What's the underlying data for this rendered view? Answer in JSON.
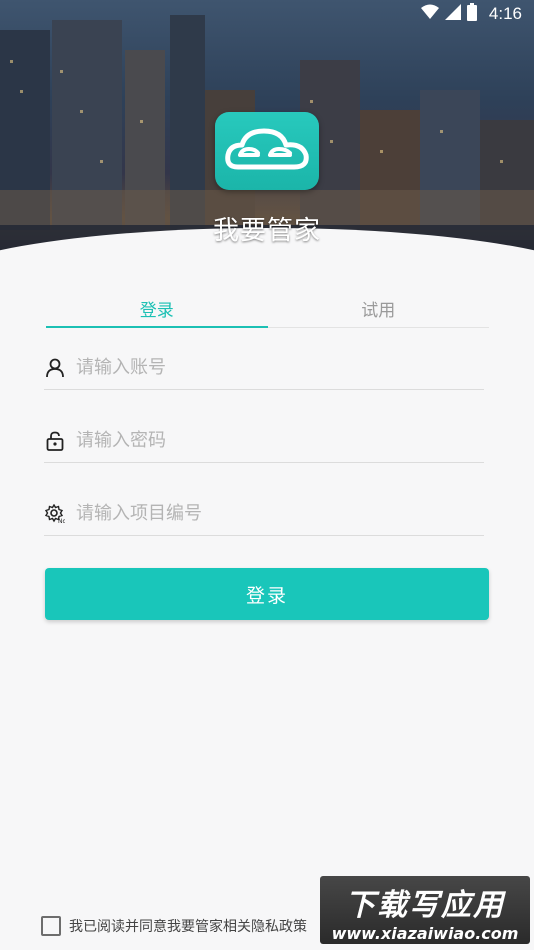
{
  "status_bar": {
    "time": "4:16"
  },
  "app": {
    "name": "我要管家"
  },
  "tabs": [
    {
      "label": "登录",
      "active": true
    },
    {
      "label": "试用",
      "active": false
    }
  ],
  "form": {
    "account_placeholder": "请输入账号",
    "password_placeholder": "请输入密码",
    "project_placeholder": "请输入项目编号",
    "login_label": "登录"
  },
  "agreement": {
    "label": "我已阅读并同意我要管家相关隐私政策",
    "checked": false
  },
  "watermark": {
    "title": "下载写应用",
    "site": "www.xiazaiwiao.com"
  },
  "colors": {
    "accent": "#1cc0b4",
    "button": "#19c6ba"
  },
  "icons": {
    "account": "user-icon",
    "password": "lock-icon",
    "project": "gear-icon"
  }
}
